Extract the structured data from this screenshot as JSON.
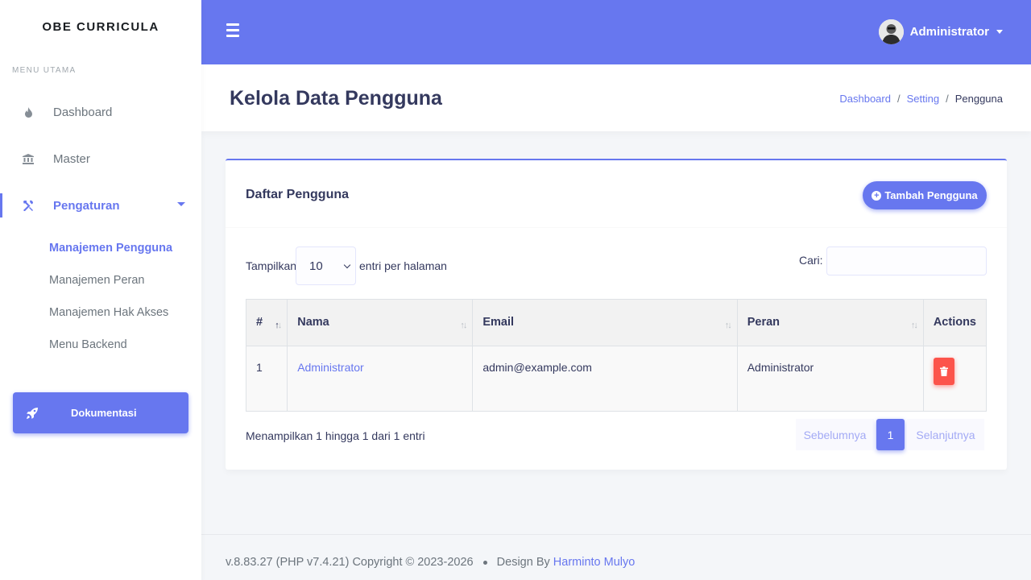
{
  "sidebar": {
    "brand": "OBE CURRICULA",
    "menu_header": "MENU UTAMA",
    "items": [
      {
        "label": "Dashboard",
        "icon": "fire-icon"
      },
      {
        "label": "Master",
        "icon": "bank-icon"
      },
      {
        "label": "Pengaturan",
        "icon": "tools-icon"
      }
    ],
    "submenu": [
      {
        "label": "Manajemen Pengguna"
      },
      {
        "label": "Manajemen Peran"
      },
      {
        "label": "Manajemen Hak Akses"
      },
      {
        "label": "Menu Backend"
      }
    ],
    "doc_button": "Dokumentasi"
  },
  "navbar": {
    "user_name": "Administrator"
  },
  "section": {
    "title": "Kelola Data Pengguna",
    "breadcrumb": [
      "Dashboard",
      "Setting",
      "Pengguna"
    ]
  },
  "card": {
    "title": "Daftar Pengguna",
    "add_button": "Tambah Pengguna",
    "length_label": "Tampilkan",
    "length_value": "10",
    "length_after": "entri per halaman",
    "search_label": "Cari:",
    "search_value": "",
    "columns": [
      "#",
      "Nama",
      "Email",
      "Peran",
      "Actions"
    ],
    "rows": [
      {
        "no": "1",
        "nama": "Administrator",
        "email": "admin@example.com",
        "peran": "Administrator"
      }
    ],
    "info": "Menampilkan 1 hingga 1 dari 1 entri",
    "pagination": {
      "prev": "Sebelumnya",
      "current": "1",
      "next": "Selanjutnya"
    }
  },
  "footer": {
    "version": "v.8.83.27 (PHP v7.4.21) Copyright © 2023-2026",
    "design_by": "Design By",
    "author": "Harminto Mulyo"
  },
  "colors": {
    "primary": "#6777ef",
    "danger": "#fc544b"
  }
}
